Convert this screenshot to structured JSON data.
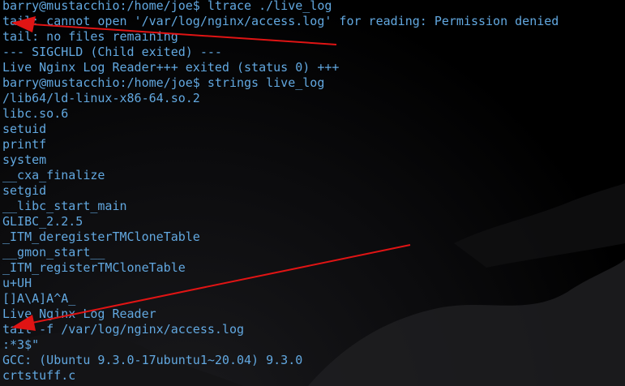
{
  "terminal": {
    "lines": [
      "barry@mustacchio:/home/joe$ ltrace ./live_log",
      "tail: cannot open '/var/log/nginx/access.log' for reading: Permission denied",
      "tail: no files remaining",
      "--- SIGCHLD (Child exited) ---",
      "Live Nginx Log Reader+++ exited (status 0) +++",
      "barry@mustacchio:/home/joe$ strings live_log",
      "/lib64/ld-linux-x86-64.so.2",
      "libc.so.6",
      "setuid",
      "printf",
      "system",
      "__cxa_finalize",
      "setgid",
      "__libc_start_main",
      "GLIBC_2.2.5",
      "_ITM_deregisterTMCloneTable",
      "__gmon_start__",
      "_ITM_registerTMCloneTable",
      "u+UH",
      "[]A\\A]A^A_",
      "Live Nginx Log Reader",
      "tail -f /var/log/nginx/access.log",
      ":*3$\"",
      "GCC: (Ubuntu 9.3.0-17ubuntu1~20.04) 9.3.0",
      "crtstuff.c"
    ],
    "text_color": "#62a8e0",
    "background_color": "#000000"
  },
  "annotations": {
    "arrow_color": "#e01414",
    "arrows": [
      "red-arrow-to-permission-denied-line",
      "red-arrow-to-tail-command-line"
    ]
  }
}
